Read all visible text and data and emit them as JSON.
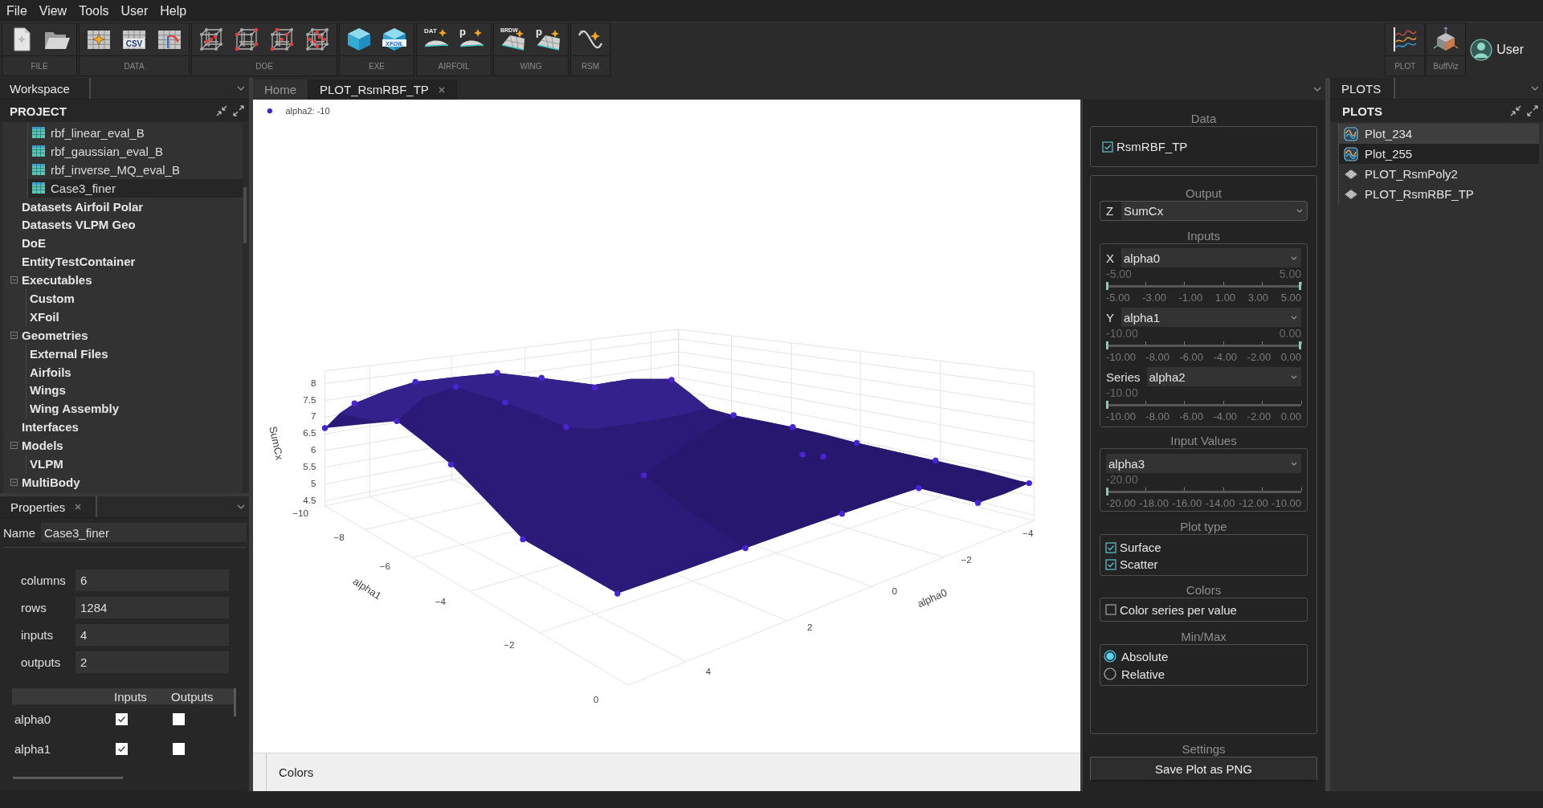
{
  "menu": [
    "File",
    "View",
    "Tools",
    "User",
    "Help"
  ],
  "toolbar": {
    "groups": [
      {
        "label": "FILE",
        "tools": [
          {
            "kind": "new-document"
          },
          {
            "kind": "open-folder"
          }
        ]
      },
      {
        "label": "DATA",
        "tools": [
          {
            "kind": "table-star"
          },
          {
            "kind": "table-text",
            "text": "CSV"
          },
          {
            "kind": "table-curve"
          }
        ]
      },
      {
        "label": "DOE",
        "tools": [
          {
            "kind": "lattice-center"
          },
          {
            "kind": "lattice-corners"
          },
          {
            "kind": "lattice-mixed"
          },
          {
            "kind": "lattice-faces"
          }
        ]
      },
      {
        "label": "EXE",
        "tools": [
          {
            "kind": "cube"
          },
          {
            "kind": "cube-text",
            "text": "XFOIL"
          }
        ]
      },
      {
        "label": "AIRFOIL",
        "tools": [
          {
            "kind": "airfoil-star",
            "text": "DAT"
          },
          {
            "kind": "airfoil-star",
            "text": "p"
          }
        ]
      },
      {
        "label": "WING",
        "tools": [
          {
            "kind": "wing-star",
            "text": "BRDW"
          },
          {
            "kind": "wing-star",
            "text": "p"
          }
        ]
      },
      {
        "label": "RSM",
        "tools": [
          {
            "kind": "curve-star"
          }
        ]
      }
    ],
    "apps": [
      {
        "label": "PLOT",
        "kind": "chart"
      },
      {
        "label": "BuffViz",
        "kind": "box3d"
      }
    ],
    "user": {
      "label": "User"
    }
  },
  "workspace": {
    "tab": {
      "label": "Workspace",
      "selected": true
    },
    "title": "PROJECT",
    "tree": {
      "continued": [
        {
          "label": "rbf_linear_eval_B",
          "kind": "table",
          "selected": false
        },
        {
          "label": "rbf_gaussian_eval_B",
          "kind": "table",
          "selected": false
        },
        {
          "label": "rbf_inverse_MQ_eval_B",
          "kind": "table",
          "selected": false
        },
        {
          "label": "Case3_finer",
          "kind": "table",
          "selected": true
        }
      ],
      "items": [
        {
          "label": "Datasets Airfoil Polar",
          "kind": "group",
          "expanded": false,
          "selected": false
        },
        {
          "label": "Datasets VLPM Geo",
          "kind": "group",
          "expanded": false,
          "selected": false
        },
        {
          "label": "DoE",
          "kind": "group",
          "expanded": false,
          "selected": false
        },
        {
          "label": "EntityTestContainer",
          "kind": "group",
          "expanded": false,
          "selected": false
        },
        {
          "label": "Executables",
          "kind": "group",
          "expanded": true,
          "selected": false,
          "children": [
            {
              "label": "Custom",
              "kind": "group",
              "expanded": false,
              "selected": false
            },
            {
              "label": "XFoil",
              "kind": "group",
              "expanded": false,
              "selected": false
            }
          ]
        },
        {
          "label": "Geometries",
          "kind": "group",
          "expanded": true,
          "selected": false,
          "children": [
            {
              "label": "External Files",
              "kind": "group",
              "expanded": false,
              "selected": false
            },
            {
              "label": "Airfoils",
              "kind": "group",
              "expanded": false,
              "selected": false
            },
            {
              "label": "Wings",
              "kind": "group",
              "expanded": false,
              "selected": false
            },
            {
              "label": "Wing Assembly",
              "kind": "group",
              "expanded": false,
              "selected": false
            }
          ]
        },
        {
          "label": "Interfaces",
          "kind": "group",
          "expanded": false,
          "selected": false
        },
        {
          "label": "Models",
          "kind": "group",
          "expanded": true,
          "selected": false,
          "children": [
            {
              "label": "VLPM",
              "kind": "group",
              "expanded": false,
              "selected": false
            }
          ]
        },
        {
          "label": "MultiBody",
          "kind": "group",
          "expanded": true,
          "selected": false
        }
      ]
    }
  },
  "properties": {
    "tab": {
      "label": "Properties",
      "selected": true
    },
    "name": {
      "label": "Name",
      "value": "Case3_finer"
    },
    "fields": [
      {
        "label": "columns",
        "value": "6"
      },
      {
        "label": "rows",
        "value": "1284"
      },
      {
        "label": "inputs",
        "value": "4"
      },
      {
        "label": "outputs",
        "value": "2"
      }
    ],
    "variables": {
      "columns": [
        "Inputs",
        "Outputs"
      ],
      "rows": [
        {
          "name": "alpha0",
          "input": true,
          "output": false
        },
        {
          "name": "alpha1",
          "input": true,
          "output": false
        }
      ]
    }
  },
  "editor": {
    "tabs": [
      {
        "label": "Home",
        "selected": false,
        "closable": false
      },
      {
        "label": "PLOT_RsmRBF_TP",
        "selected": true,
        "closable": true
      }
    ],
    "plot": {
      "legend": "alpha2: -10",
      "z_axis": {
        "title": "SumCx",
        "ticks": [
          "8",
          "7.5",
          "7",
          "6.5",
          "6",
          "5.5",
          "5",
          "4.5"
        ]
      },
      "y_axis": {
        "title": "alpha1",
        "ticks": [
          "−10",
          "−8",
          "−6",
          "−4",
          "−2",
          "0"
        ]
      },
      "x_axis": {
        "title": "alpha0",
        "ticks": [
          "4",
          "2",
          "0",
          "−2",
          "−4"
        ]
      }
    },
    "bottom_panel": {
      "title": "Colors"
    }
  },
  "controls": {
    "data": {
      "title": "Data",
      "series": [
        {
          "label": "RsmRBF_TP",
          "checked": true
        }
      ]
    },
    "output": {
      "title": "Output",
      "axis": "Z",
      "value": "SumCx"
    },
    "inputs": {
      "title": "Inputs",
      "rows": [
        {
          "axis": "X",
          "value": "alpha0",
          "range_labels": [
            "-5.00",
            "5.00"
          ],
          "handles": [
            {
              "level": 0
            },
            {
              "level": 1
            }
          ],
          "ticks": [
            "-5.00",
            "-3.00",
            "-1.00",
            "1.00",
            "3.00",
            "5.00"
          ]
        },
        {
          "axis": "Y",
          "value": "alpha1",
          "range_labels": [
            "-10.00",
            "0.00"
          ],
          "handles": [
            {
              "level": 0
            },
            {
              "level": 1
            }
          ],
          "ticks": [
            "-10.00",
            "-8.00",
            "-6.00",
            "-4.00",
            "-2.00",
            "0.00"
          ]
        },
        {
          "axis": "Series",
          "value": "alpha2",
          "range_labels": [
            "-10.00"
          ],
          "handles": [
            {
              "level": 0
            }
          ],
          "ticks": [
            "-10.00",
            "-8.00",
            "-6.00",
            "-4.00",
            "-2.00",
            "0.00"
          ]
        }
      ]
    },
    "input_values": {
      "title": "Input Values",
      "rows": [
        {
          "value": "alpha3",
          "range_labels": [
            "-20.00"
          ],
          "handles": [
            {
              "level": 0
            }
          ],
          "ticks": [
            "-20.00",
            "-18.00",
            "-16.00",
            "-14.00",
            "-12.00",
            "-10.00"
          ]
        }
      ]
    },
    "plot_type": {
      "title": "Plot type",
      "options": [
        {
          "label": "Surface",
          "checked": true
        },
        {
          "label": "Scatter",
          "checked": true
        }
      ]
    },
    "colors": {
      "title": "Colors",
      "options": [
        {
          "label": "Color series per value",
          "checked": false
        }
      ]
    },
    "min_max": {
      "title": "Min/Max",
      "options": [
        {
          "label": "Absolute",
          "selected": true
        },
        {
          "label": "Relative",
          "selected": false
        }
      ]
    },
    "settings": {
      "title": "Settings",
      "button": "Save Plot as PNG"
    }
  },
  "plots": {
    "tab": {
      "label": "PLOTS",
      "selected": true
    },
    "title": "PLOTS",
    "items": [
      {
        "label": "Plot_234",
        "kind": "line",
        "selected": false,
        "hovered": true
      },
      {
        "label": "Plot_255",
        "kind": "line",
        "selected": true,
        "hovered": false
      },
      {
        "label": "PLOT_RsmPoly2",
        "kind": "surface",
        "selected": false,
        "hovered": false
      },
      {
        "label": "PLOT_RsmRBF_TP",
        "kind": "surface",
        "selected": false,
        "hovered": false
      }
    ]
  }
}
